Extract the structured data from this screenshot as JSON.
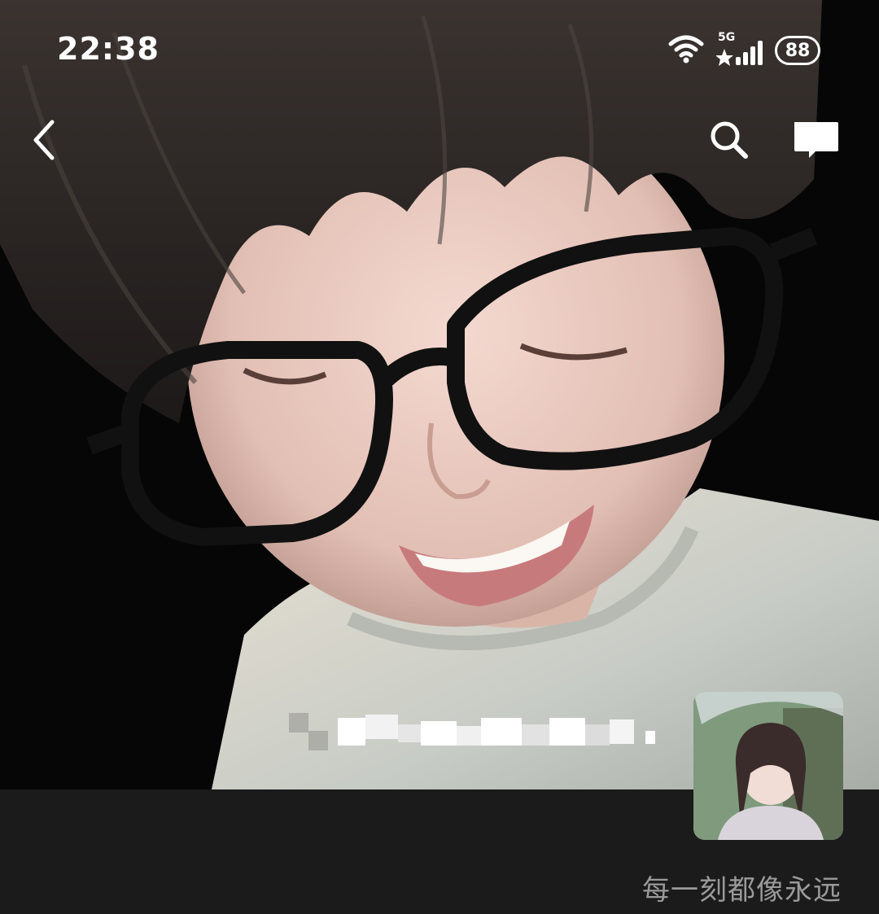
{
  "status_bar": {
    "time": "22:38",
    "network": "5G",
    "battery": "88",
    "wifi_icon": "wifi-icon",
    "signal_icon": "signal-icon"
  },
  "nav": {
    "back_icon": "chevron-left-icon",
    "search_icon": "search-icon",
    "message_icon": "message-icon"
  },
  "profile": {
    "signature": "每一刻都像永远"
  },
  "colors": {
    "background": "#1b1b1b",
    "signature_text": "#9a9a9a",
    "icon": "#ffffff"
  }
}
